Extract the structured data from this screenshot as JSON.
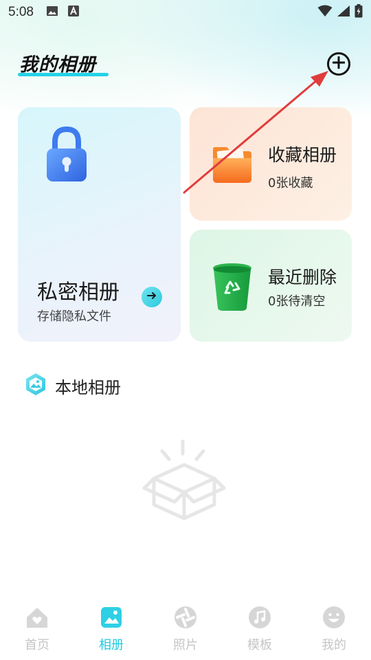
{
  "status_bar": {
    "time": "5:08",
    "icons": [
      "image-icon",
      "a-badge-icon"
    ],
    "right_icons": [
      "wifi-icon",
      "signal-icon",
      "battery-charging-icon"
    ]
  },
  "header": {
    "title": "我的相册",
    "add_icon": "plus-circle-icon"
  },
  "cards": {
    "private": {
      "title": "私密相册",
      "subtitle": "存储隐私文件",
      "icon": "lock-icon"
    },
    "favorites": {
      "title": "收藏相册",
      "subtitle": "0张收藏",
      "icon": "folder-icon"
    },
    "deleted": {
      "title": "最近删除",
      "subtitle": "0张待清空",
      "icon": "recycle-bin-icon"
    }
  },
  "local": {
    "title": "本地相册",
    "empty_icon": "empty-box-icon"
  },
  "bottom_nav": [
    {
      "label": "首页",
      "icon": "home-icon",
      "active": false
    },
    {
      "label": "相册",
      "icon": "album-icon",
      "active": true
    },
    {
      "label": "照片",
      "icon": "camera-aperture-icon",
      "active": false
    },
    {
      "label": "模板",
      "icon": "music-note-icon",
      "active": false
    },
    {
      "label": "我的",
      "icon": "smiley-icon",
      "active": false
    }
  ],
  "colors": {
    "accent": "#1fcbe0",
    "annotation_arrow": "#e03c3c",
    "nav_inactive": "#c5c5c5"
  }
}
